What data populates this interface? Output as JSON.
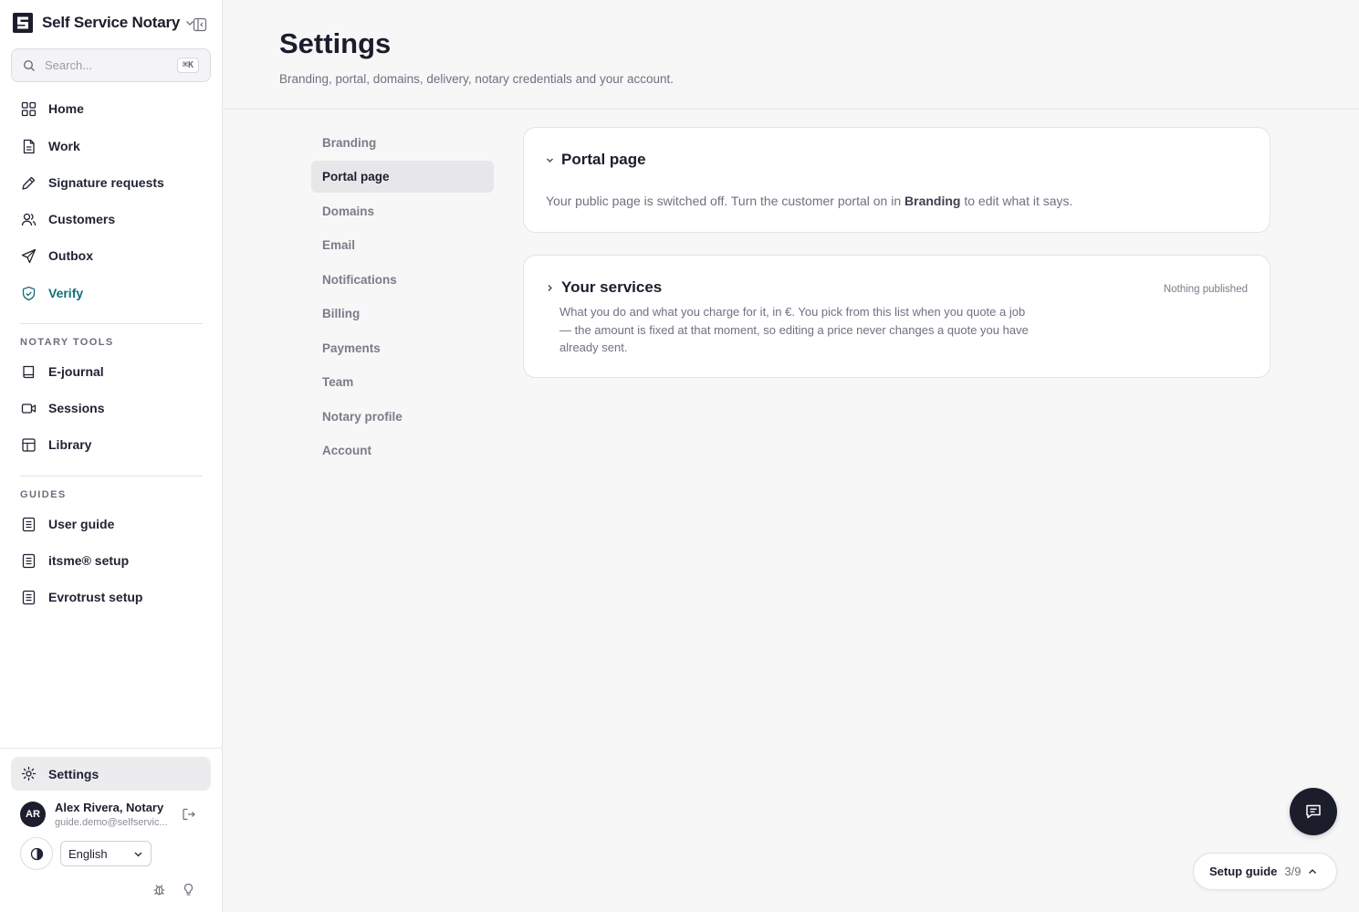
{
  "app": {
    "name": "Self Service Notary"
  },
  "search": {
    "placeholder": "Search...",
    "shortcut": "⌘K"
  },
  "sidebar": {
    "main_items": [
      {
        "label": "Home",
        "icon": "grid-icon"
      },
      {
        "label": "Work",
        "icon": "document-icon"
      },
      {
        "label": "Signature requests",
        "icon": "pen-icon"
      },
      {
        "label": "Customers",
        "icon": "users-icon"
      },
      {
        "label": "Outbox",
        "icon": "send-icon"
      },
      {
        "label": "Verify",
        "icon": "shield-check-icon"
      }
    ],
    "notary_tools_title": "NOTARY TOOLS",
    "notary_tools": [
      {
        "label": "E-journal",
        "icon": "book-icon"
      },
      {
        "label": "Sessions",
        "icon": "video-icon"
      },
      {
        "label": "Library",
        "icon": "library-icon"
      }
    ],
    "guides_title": "GUIDES",
    "guides": [
      {
        "label": "User guide",
        "icon": "guide-book-icon"
      },
      {
        "label": "itsme® setup",
        "icon": "guide-book-icon"
      },
      {
        "label": "Evrotrust setup",
        "icon": "guide-book-icon"
      }
    ],
    "settings_label": "Settings",
    "verify_color": "#0f6f7a"
  },
  "user": {
    "initials": "AR",
    "name": "Alex Rivera, Notary",
    "email": "guide.demo@selfservic..."
  },
  "language": {
    "selected": "English"
  },
  "header": {
    "title": "Settings",
    "subtitle": "Branding, portal, domains, delivery, notary credentials and your account."
  },
  "settings_nav": {
    "active": "Portal page",
    "items": [
      "Branding",
      "Portal page",
      "Domains",
      "Email",
      "Notifications",
      "Billing",
      "Payments",
      "Team",
      "Notary profile",
      "Account"
    ]
  },
  "portal_card": {
    "title": "Portal page",
    "text_before": "Your public page is switched off. Turn the customer portal on in ",
    "text_bold": "Branding",
    "text_after": " to edit what it says."
  },
  "services_card": {
    "title": "Your services",
    "status": "Nothing published",
    "description": "What you do and what you charge for it, in €. You pick from this list when you quote a job — the amount is fixed at that moment, so editing a price never changes a quote you have already sent."
  },
  "setup_guide": {
    "label": "Setup guide",
    "progress": "3/9"
  }
}
